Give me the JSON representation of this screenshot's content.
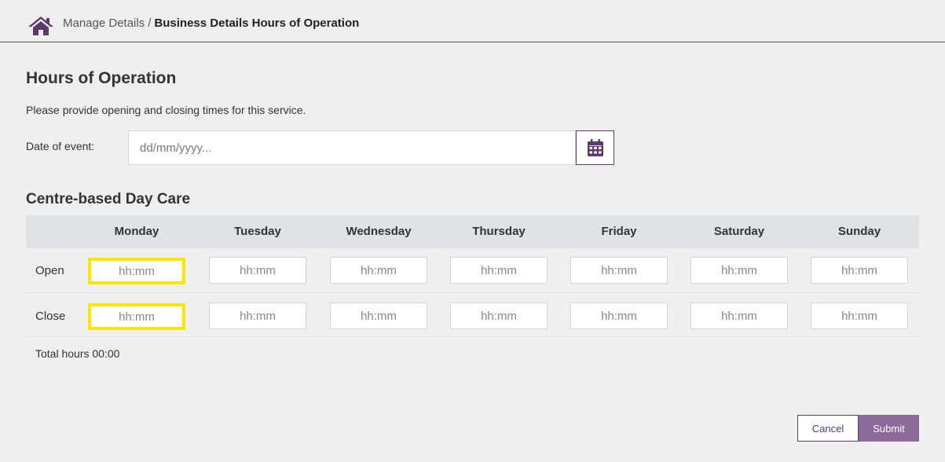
{
  "breadcrumb": {
    "parent": "Manage Details",
    "separator": "/",
    "current": "Business Details Hours of Operation"
  },
  "page": {
    "title": "Hours of Operation",
    "instructions": "Please provide opening and closing times for this service."
  },
  "date_field": {
    "label": "Date of event:",
    "placeholder": "dd/mm/yyyy..."
  },
  "section": {
    "title": "Centre-based Day Care"
  },
  "days": [
    "Monday",
    "Tuesday",
    "Wednesday",
    "Thursday",
    "Friday",
    "Saturday",
    "Sunday"
  ],
  "rows": {
    "open_label": "Open",
    "close_label": "Close",
    "placeholder": "hh:mm"
  },
  "total": {
    "text": "Total hours 00:00"
  },
  "buttons": {
    "cancel": "Cancel",
    "submit": "Submit"
  },
  "colors": {
    "brand": "#5b3a6c",
    "submit_bg": "#8c6a9c",
    "highlight": "#ffe500",
    "header_bg": "#dfe3e8"
  },
  "icons": {
    "home": "home-icon",
    "calendar": "calendar-icon"
  }
}
